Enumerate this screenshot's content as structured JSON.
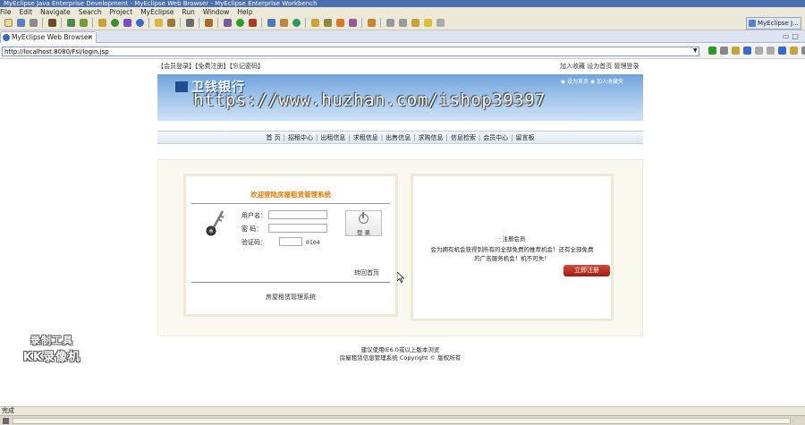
{
  "window": {
    "title": "MyEclipse Java Enterprise Development - MyEclipse Web Browser - MyEclipse Enterprise Workbench"
  },
  "menu": {
    "items": [
      "File",
      "Edit",
      "Navigate",
      "Search",
      "Project",
      "MyEclipse",
      "Run",
      "Window",
      "Help"
    ]
  },
  "perspective": {
    "label": "MyEclipse J..."
  },
  "tab": {
    "label": "MyEclipse Web Browser",
    "close": "✕"
  },
  "tab_controls": "▭□",
  "address": {
    "url": "http://localhost:8080/Fsl/login.jsp"
  },
  "site": {
    "toplinks_left": "【会员登录】【免费注册】【忘记密码】",
    "toplinks_right": "加入收藏  设为首页  管理登录",
    "banner_logo": "卫钱银行",
    "banner_links": "◉ 设为首页    ◉ 加入收藏夹",
    "watermark": "https://www.huzhan.com/ishop39397",
    "nav": [
      "首 页",
      "招租中心",
      "出租信息",
      "求租信息",
      "出售信息",
      "求购信息",
      "信息检索",
      "会员中心",
      "留言板"
    ]
  },
  "login": {
    "title": "欢迎登陆房屋租赁管理系统",
    "username_label": "用户名：",
    "password_label": "密  码：",
    "captcha_label": "验证码：",
    "captcha_code": "0104",
    "button_label": "登  录",
    "back_home": "转回首页",
    "footer": "房屋租赁管理系统"
  },
  "register": {
    "title": "· 注册会员",
    "text1": "会为拥有机会获得到所有的全部免费的推荐机会！还有全部免费",
    "text2": "的广告服务机会！机不可失！",
    "button": "立即注册"
  },
  "footer": {
    "line1": "建议使用IE6.0或以上版本浏览",
    "line2": "房屋租赁信息管理系统 Copyright © 版权所有"
  },
  "overlay": {
    "line1": "录制工具",
    "line2": "KK录像机"
  },
  "status": {
    "text": "完成"
  },
  "colors": {
    "accent_orange": "#e07a00",
    "register_red": "#b8261b",
    "banner_blue": "#6fa3dc"
  }
}
